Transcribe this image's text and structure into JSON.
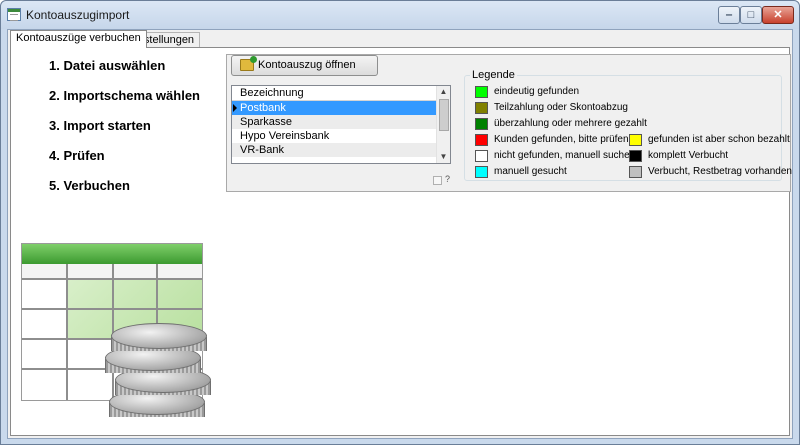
{
  "window": {
    "title": "Kontoauszugimport",
    "controls": {
      "minimize": "‒",
      "maximize": "□",
      "close": "✕"
    }
  },
  "tabs": [
    {
      "label": "Kontoauszüge verbuchen",
      "active": true
    },
    {
      "label": "Einstellungen",
      "active": false
    }
  ],
  "steps": [
    "1. Datei auswählen",
    "2. Importschema wählen",
    "3. Import starten",
    "4. Prüfen",
    "5. Verbuchen"
  ],
  "open_button": {
    "label": "Kontoauszug öffnen",
    "icon": "folder-open-icon"
  },
  "bank_list": {
    "header": "Bezeichnung",
    "rows": [
      "Postbank",
      "Sparkasse",
      "Hypo Vereinsbank",
      "VR-Bank"
    ],
    "selected_index": 0
  },
  "question_label": "?",
  "legend": {
    "title": "Legende",
    "items": [
      {
        "label": "eindeutig gefunden",
        "color": "#00ff00"
      },
      {
        "label": "Teilzahlung oder Skontoabzug",
        "color": "#808000"
      },
      {
        "label": "überzahlung oder mehrere gezahlt",
        "color": "#008000"
      },
      {
        "label": "Kunden gefunden, bitte prüfen",
        "color": "#ff0000"
      },
      {
        "label": "gefunden ist aber schon bezahlt",
        "color": "#ffff00"
      },
      {
        "label": "nicht gefunden, manuell suchen",
        "color": "#ffffff"
      },
      {
        "label": "komplett Verbucht",
        "color": "#000000"
      },
      {
        "label": "manuell gesucht",
        "color": "#00ffff"
      },
      {
        "label": "Verbucht, Restbetrag vorhanden",
        "color": "#c0c0c0"
      }
    ]
  }
}
